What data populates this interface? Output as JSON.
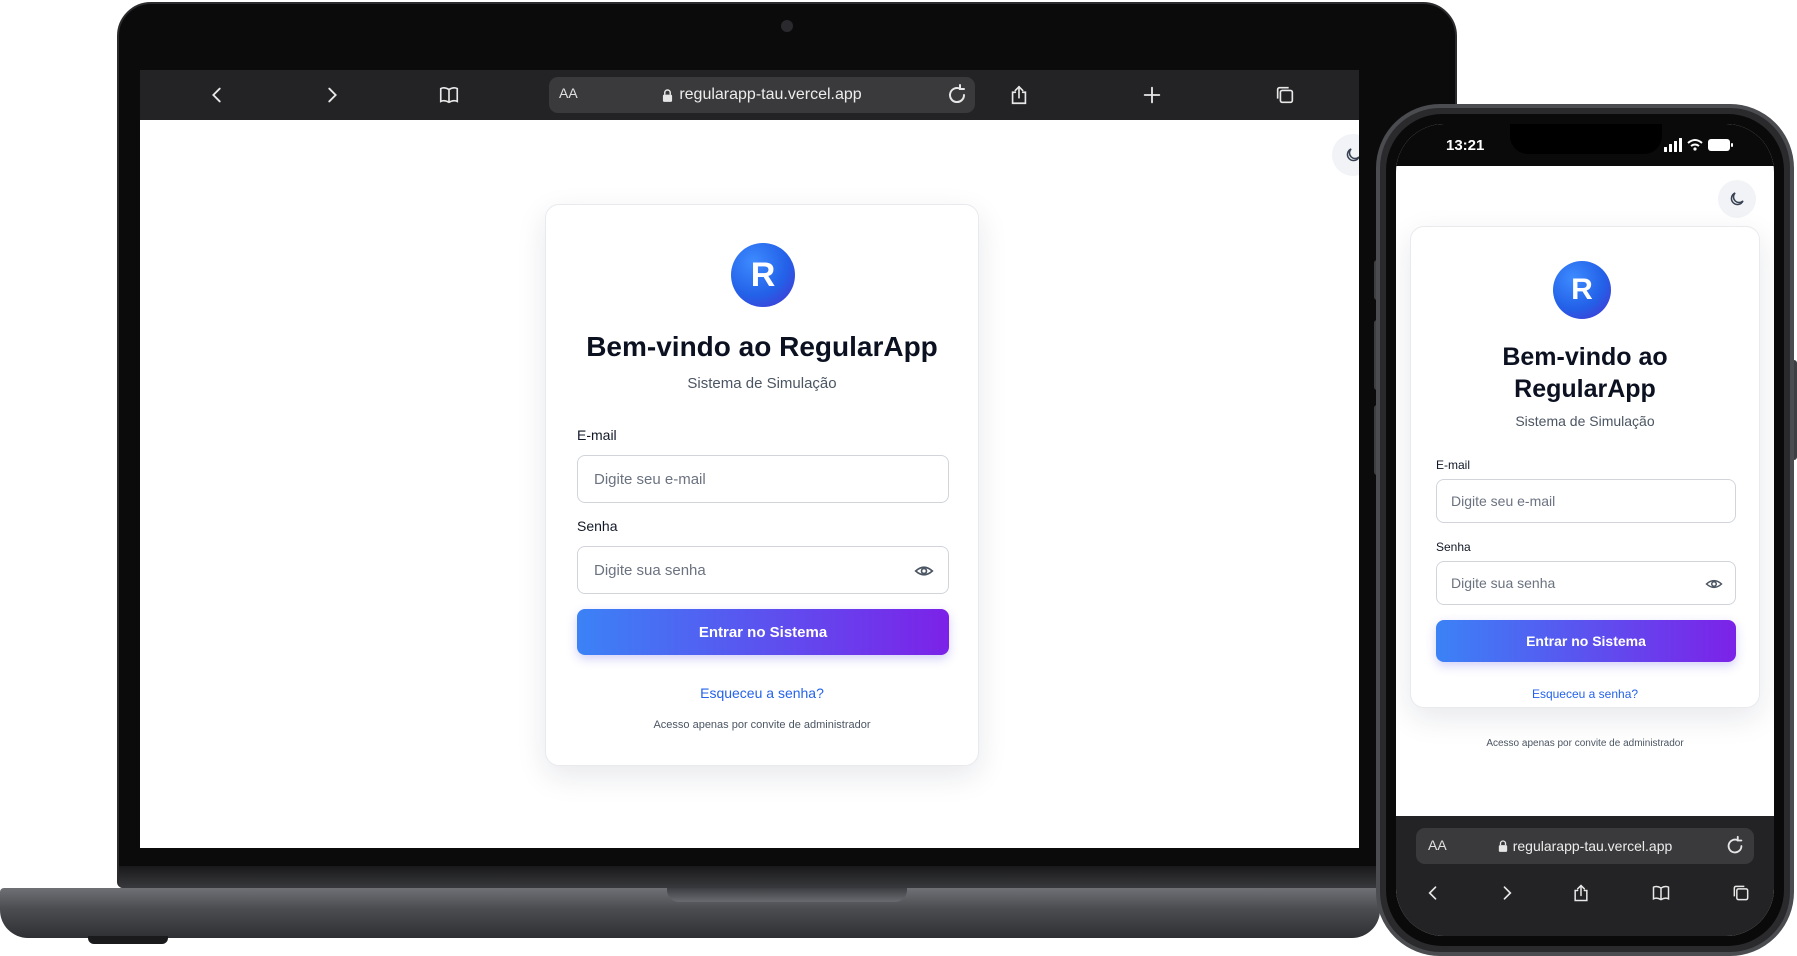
{
  "laptop": {
    "browser": {
      "url": "regularapp-tau.vercel.app",
      "text_size_label": "AA",
      "icons": [
        "back-icon",
        "forward-icon",
        "bookmarks-icon",
        "lock-icon",
        "reload-icon",
        "share-icon",
        "new-tab-icon",
        "tabs-icon"
      ]
    }
  },
  "phone": {
    "status_time": "13:21",
    "browser": {
      "url": "regularapp-tau.vercel.app",
      "text_size_label": "AA"
    }
  },
  "login": {
    "title": "Bem-vindo ao RegularApp",
    "title_line1": "Bem-vindo ao",
    "title_line2": "RegularApp",
    "subtitle": "Sistema de Simulação",
    "email_label": "E-mail",
    "email_placeholder": "Digite seu e-mail",
    "password_label": "Senha",
    "password_placeholder": "Digite sua senha",
    "submit_label": "Entrar no Sistema",
    "forgot_link": "Esqueceu a senha?",
    "note": "Acesso apenas por convite de administrador",
    "logo_letter": "R"
  },
  "colors": {
    "gradient_start": "#3b82f6",
    "gradient_end": "#7c22e8",
    "link": "#2563eb",
    "toolbar": "#232325"
  }
}
